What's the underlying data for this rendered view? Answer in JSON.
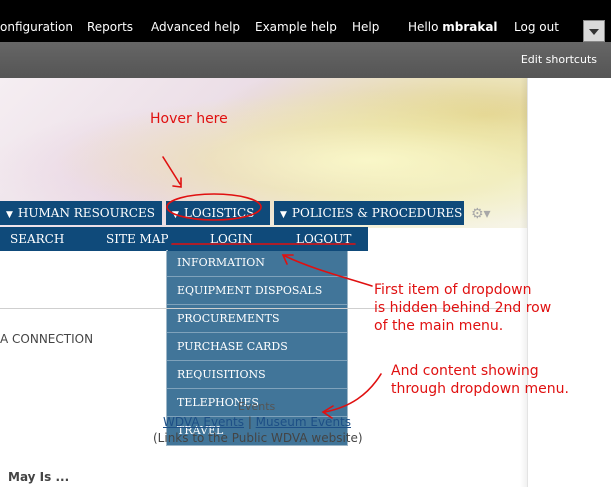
{
  "toolbar": {
    "items": [
      "onfiguration",
      "Reports",
      "Advanced help",
      "Example help",
      "Help"
    ],
    "hello_prefix": "Hello ",
    "username": "mbrakal",
    "logout": "Log out"
  },
  "shortcuts": {
    "edit_label": "Edit shortcuts"
  },
  "menu_row1": [
    {
      "label": "HUMAN RESOURCES",
      "arrow": "▼"
    },
    {
      "label": "LOGISTICS",
      "arrow": "▼"
    },
    {
      "label": "POLICIES & PROCEDURES",
      "arrow": "▼"
    }
  ],
  "menu_row2": [
    "SEARCH",
    "SITE MAP",
    "LOGIN",
    "LOGOUT"
  ],
  "dropdown": [
    "INFORMATION",
    "EQUIPMENT DISPOSALS",
    "PROCUREMENTS",
    "PURCHASE CARDS",
    "REQUISITIONS",
    "TELEPHONES",
    "TRAVEL"
  ],
  "content": {
    "connection": "A CONNECTION",
    "events_heading": "Events",
    "link_wdva": "WDVA Events",
    "separator": " | ",
    "link_museum": "Museum Events",
    "public_note": "(Links to the Public WDVA website)",
    "may_is": "May Is ..."
  },
  "annotations": {
    "hover": "Hover here",
    "first_item": [
      "First item of dropdown",
      "is hidden behind 2nd row",
      "of the main menu."
    ],
    "content_show": [
      "And content showing",
      "through dropdown menu."
    ]
  },
  "colors": {
    "menu_bg": "#0f4a7a",
    "dropdown_bg": "#417599",
    "annotation": "#e01010"
  }
}
